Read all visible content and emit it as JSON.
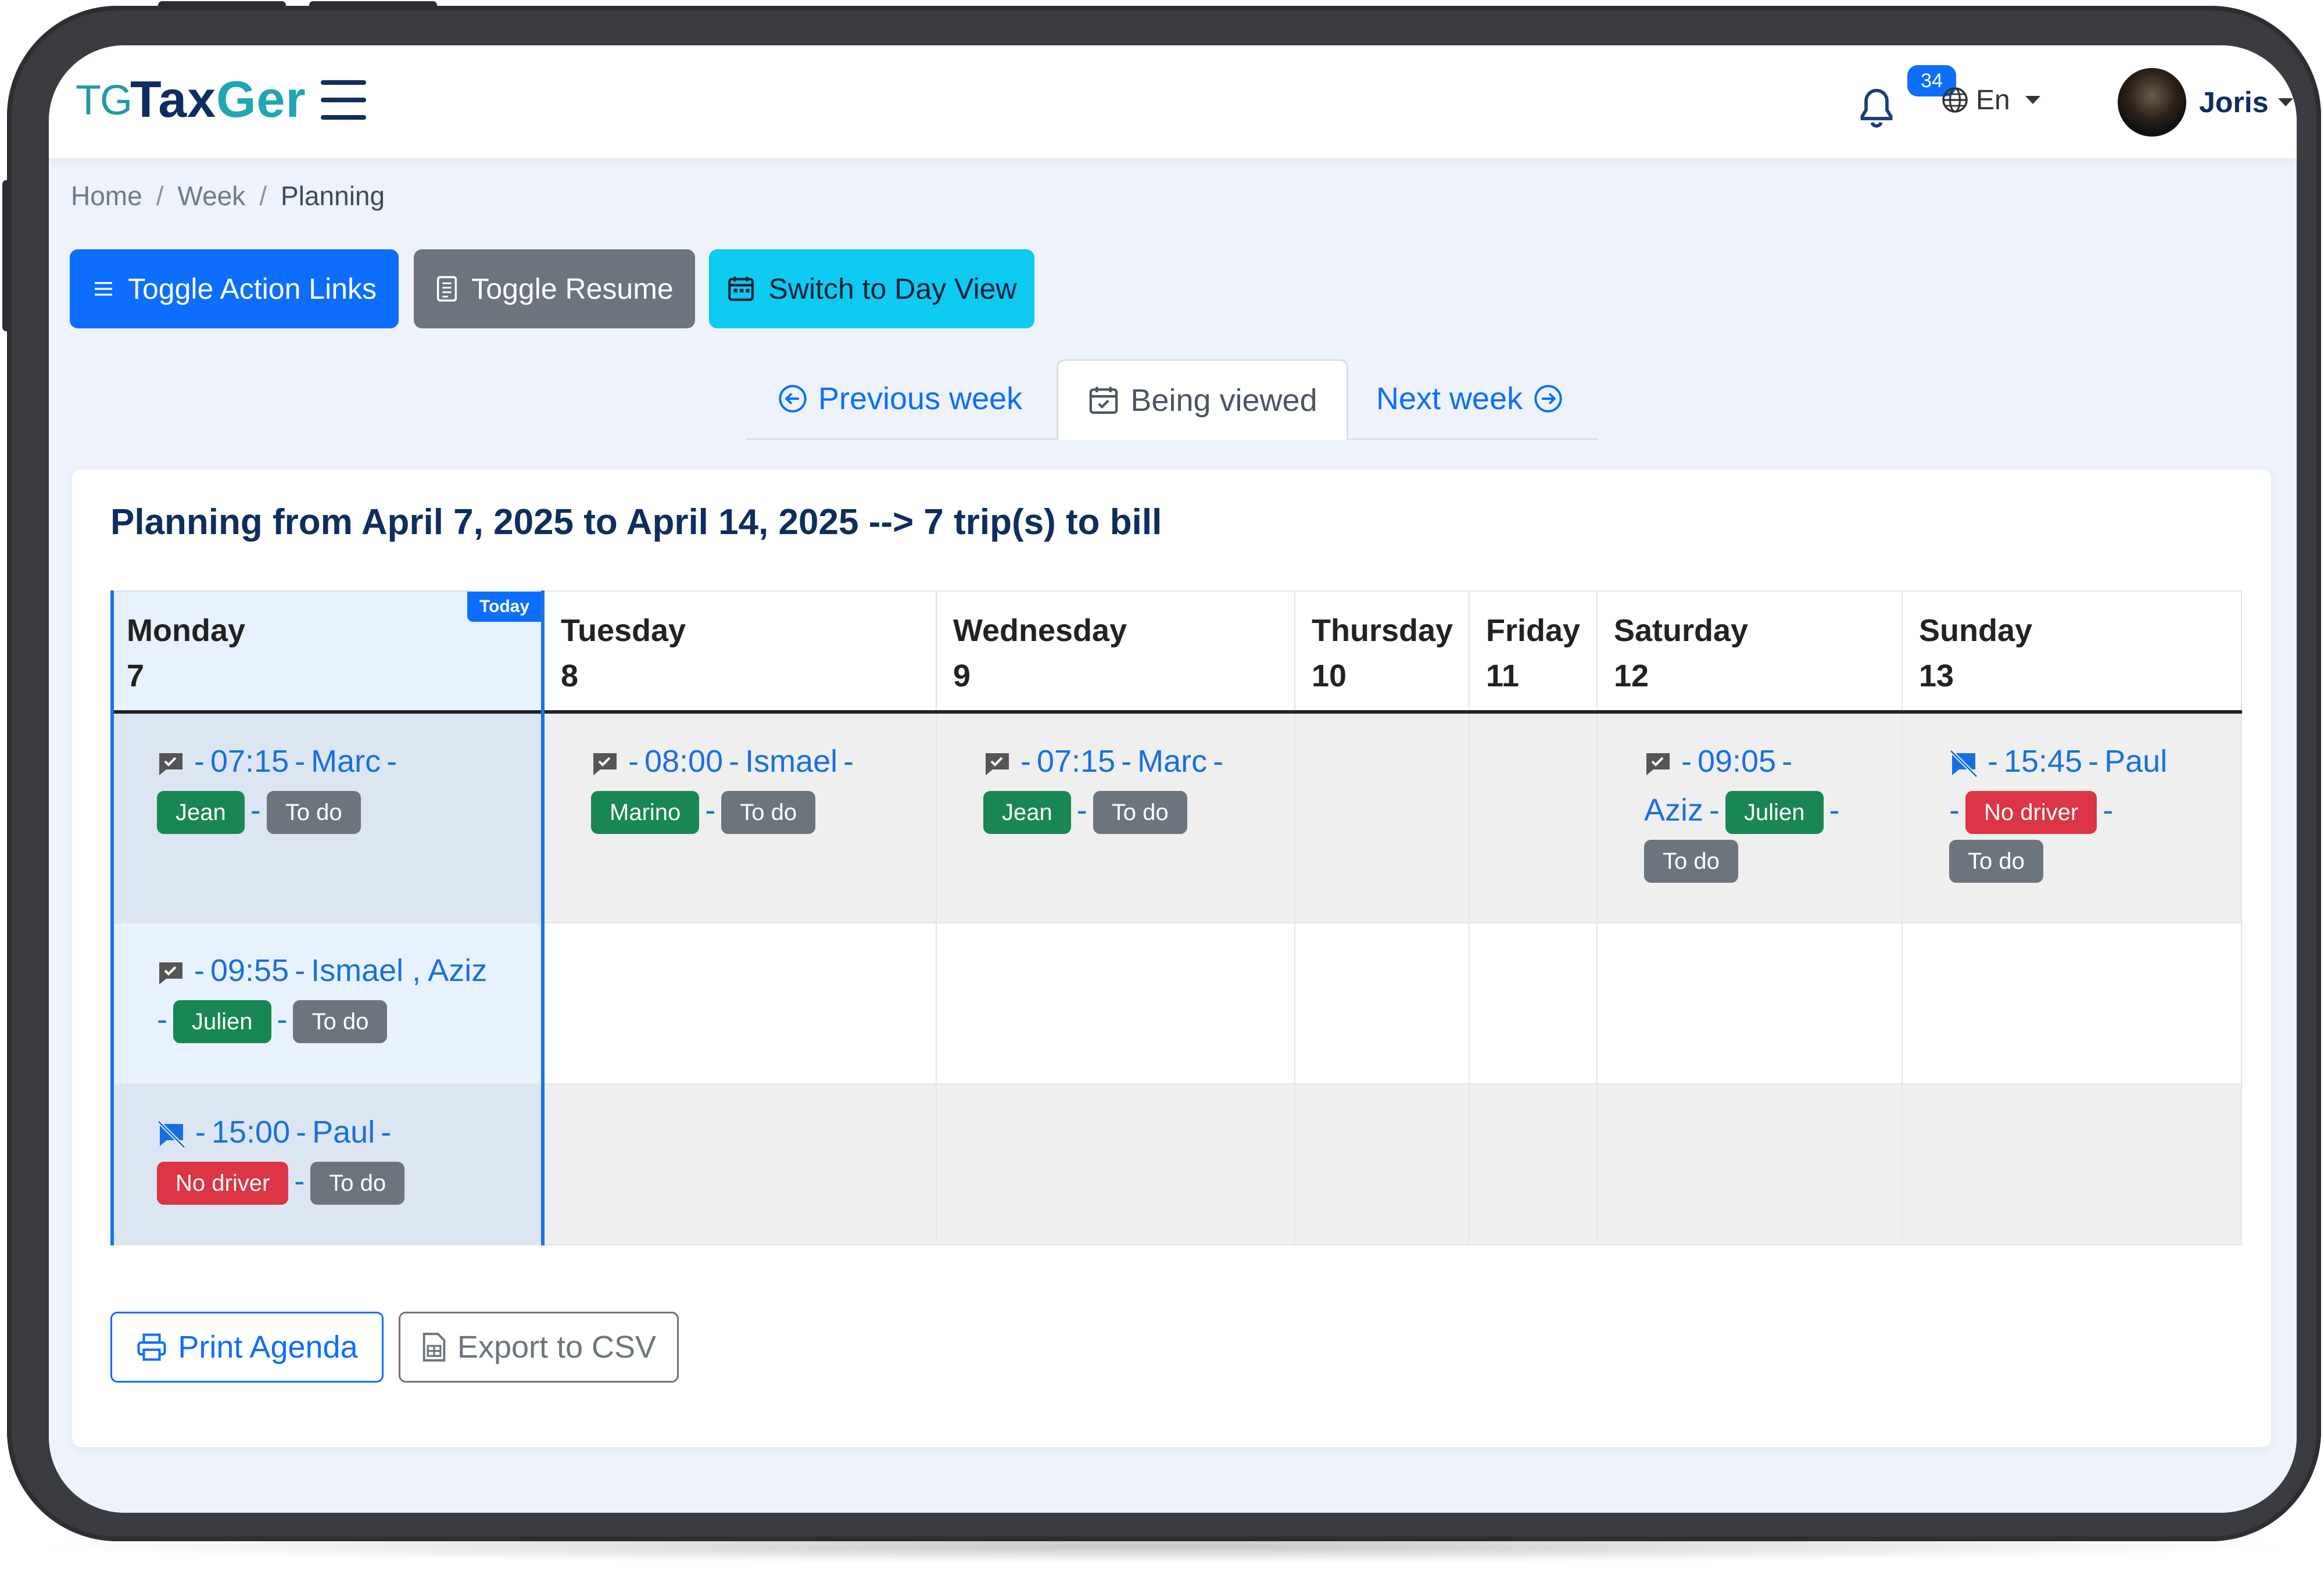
{
  "brand": {
    "mark": "TG",
    "name_part1": "Tax",
    "name_part2": "Ger"
  },
  "header": {
    "notifications_count": "34",
    "language": "En",
    "user_name": "Joris"
  },
  "breadcrumb": [
    "Home",
    "Week",
    "Planning"
  ],
  "actions": {
    "toggle_links": "Toggle Action Links",
    "toggle_resume": "Toggle Resume",
    "switch_view": "Switch to Day View"
  },
  "week_nav": {
    "previous": "Previous week",
    "current": "Being viewed",
    "next": "Next week"
  },
  "planning": {
    "title": "Planning from April 7, 2025 to April 14, 2025 --> 7 trip(s) to bill",
    "today_label": "Today",
    "days": [
      {
        "name": "Monday",
        "date": "7"
      },
      {
        "name": "Tuesday",
        "date": "8"
      },
      {
        "name": "Wednesday",
        "date": "9"
      },
      {
        "name": "Thursday",
        "date": "10"
      },
      {
        "name": "Friday",
        "date": "11"
      },
      {
        "name": "Saturday",
        "date": "12"
      },
      {
        "name": "Sunday",
        "date": "13"
      }
    ],
    "trips": [
      {
        "day": "Monday",
        "time": "07:15",
        "client": "Marc",
        "driver": "Jean",
        "status": "To do",
        "icon": "message-check-icon"
      },
      {
        "day": "Monday",
        "time": "09:55",
        "client": "Ismael , Aziz",
        "driver": "Julien",
        "status": "To do",
        "icon": "message-check-icon"
      },
      {
        "day": "Monday",
        "time": "15:00",
        "client": "Paul",
        "driver": "No driver",
        "status": "To do",
        "icon": "message-off-icon"
      },
      {
        "day": "Tuesday",
        "time": "08:00",
        "client": "Ismael",
        "driver": "Marino",
        "status": "To do",
        "icon": "message-check-icon"
      },
      {
        "day": "Wednesday",
        "time": "07:15",
        "client": "Marc",
        "driver": "Jean",
        "status": "To do",
        "icon": "message-check-icon"
      },
      {
        "day": "Saturday",
        "time": "09:05",
        "client": "Aziz",
        "driver": "Julien",
        "status": "To do",
        "icon": "message-check-icon"
      },
      {
        "day": "Sunday",
        "time": "15:45",
        "client": "Paul",
        "driver": "No driver",
        "status": "To do",
        "icon": "message-off-icon"
      }
    ]
  },
  "footer": {
    "print": "Print Agenda",
    "export": "Export to CSV"
  },
  "colors": {
    "primary": "#0d6efd",
    "secondary": "#6c757d",
    "info": "#0dcaf0",
    "success": "#198754",
    "danger": "#dc3545",
    "navy": "#0f2d5e",
    "teal": "#1fa7b2"
  }
}
